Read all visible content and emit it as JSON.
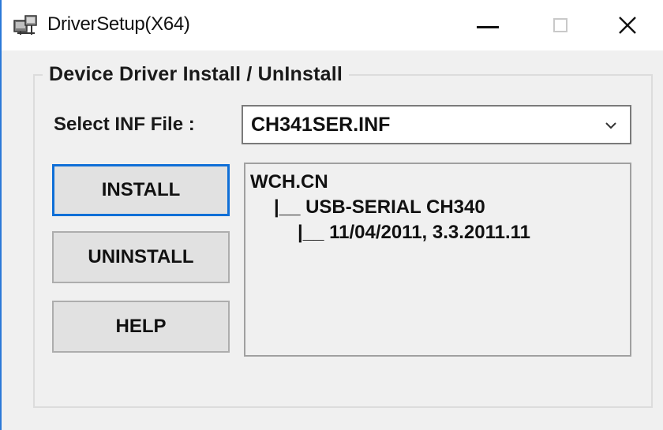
{
  "window": {
    "title": "DriverSetup(X64)",
    "icon": "driver-setup-icon"
  },
  "titlebar": {
    "minimize_icon": "minimize-icon",
    "maximize_icon": "maximize-icon",
    "close_icon": "close-icon",
    "close_glyph": "✕"
  },
  "group": {
    "legend": "Device Driver Install / UnInstall"
  },
  "inf_select": {
    "label": "Select INF File :",
    "value": "CH341SER.INF",
    "arrow_icon": "chevron-down-icon"
  },
  "buttons": {
    "install": "INSTALL",
    "uninstall": "UNINSTALL",
    "help": "HELP"
  },
  "info": {
    "lines": [
      "WCH.CN",
      "|__ USB-SERIAL CH340",
      "|__ 11/04/2011, 3.3.2011.11"
    ]
  },
  "colors": {
    "accent": "#0f6fd7",
    "window_bg": "#f0f0f0",
    "titlebar_bg": "#ffffff",
    "window_border": "#2b79d8"
  }
}
